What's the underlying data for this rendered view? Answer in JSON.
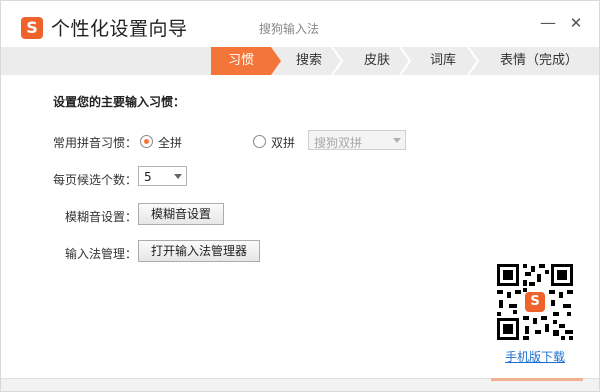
{
  "window": {
    "logo_letter": "S",
    "title": "个性化设置向导",
    "subtitle": "搜狗输入法",
    "minimize_glyph": "—",
    "close_glyph": "✕"
  },
  "steps": [
    {
      "label": "习惯",
      "active": true
    },
    {
      "label": "搜索",
      "active": false
    },
    {
      "label": "皮肤",
      "active": false
    },
    {
      "label": "词库",
      "active": false
    },
    {
      "label": "表情（完成）",
      "active": false
    }
  ],
  "content": {
    "heading": "设置您的主要输入习惯：",
    "pinyin_label": "常用拼音习惯：",
    "option_full": "全拼",
    "option_double": "双拼",
    "selected_option": "全拼",
    "double_scheme_value": "搜狗双拼",
    "candidates_label": "每页候选个数：",
    "candidates_value": "5",
    "fuzzy_label": "模糊音设置：",
    "fuzzy_button": "模糊音设置",
    "manager_label": "输入法管理：",
    "manager_button": "打开输入法管理器"
  },
  "qr": {
    "logo_letter": "S",
    "download_link": "手机版下载"
  },
  "colors": {
    "accent": "#f3753a",
    "logo": "#f0622b",
    "link": "#1b6fd1"
  }
}
